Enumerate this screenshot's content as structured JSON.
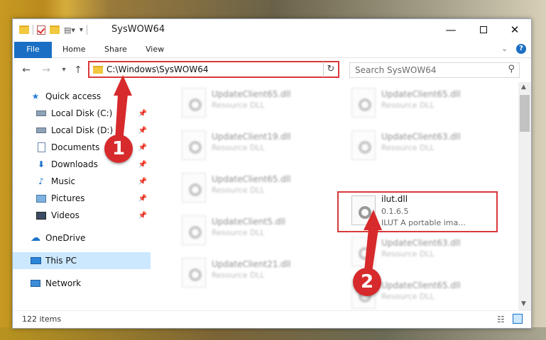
{
  "window": {
    "title": "SysWOW64"
  },
  "ribbon": {
    "tabs": [
      "File",
      "Home",
      "Share",
      "View"
    ]
  },
  "address": {
    "path": "C:\\Windows\\SysWOW64"
  },
  "search": {
    "placeholder": "Search SysWOW64"
  },
  "sidebar": {
    "items": [
      {
        "label": "Quick access",
        "icon": "star-icon"
      },
      {
        "label": "Local Disk (C:)",
        "icon": "drive-icon",
        "pinned": true
      },
      {
        "label": "Local Disk (D:)",
        "icon": "drive-icon",
        "pinned": true
      },
      {
        "label": "Documents",
        "icon": "documents-icon",
        "pinned": true
      },
      {
        "label": "Downloads",
        "icon": "download-icon",
        "pinned": true
      },
      {
        "label": "Music",
        "icon": "music-icon",
        "pinned": true
      },
      {
        "label": "Pictures",
        "icon": "pictures-icon",
        "pinned": true
      },
      {
        "label": "Videos",
        "icon": "videos-icon",
        "pinned": true
      },
      {
        "label": "OneDrive",
        "icon": "cloud-icon"
      },
      {
        "label": "This PC",
        "icon": "computer-icon",
        "selected": true
      },
      {
        "label": "Network",
        "icon": "network-icon"
      }
    ]
  },
  "files": {
    "left": [
      {
        "name": "UpdateClient65.dll",
        "type": "Resource DLL"
      },
      {
        "name": "UpdateClient19.dll",
        "type": "Resource DLL"
      },
      {
        "name": "UpdateClient65.dll",
        "type": "Resource DLL"
      },
      {
        "name": "UpdateClient5.dll",
        "type": "Resource DLL"
      },
      {
        "name": "UpdateClient21.dll",
        "type": "Resource DLL"
      }
    ],
    "right": [
      {
        "name": "UpdateClient65.dll",
        "type": "Resource DLL"
      },
      {
        "name": "UpdateClient63.dll",
        "type": "Resource DLL"
      },
      {
        "name": "ilut.dll",
        "version": "0.1.6.5",
        "description": "ILUT A portable ima...",
        "highlighted": true
      },
      {
        "name": "UpdateClient63.dll",
        "type": "Resource DLL"
      },
      {
        "name": "UpdateClient65.dll",
        "type": "Resource DLL"
      }
    ]
  },
  "status": {
    "item_count": "122 items"
  },
  "annotations": {
    "step1": "1",
    "step2": "2",
    "color": "#d72a2c"
  }
}
